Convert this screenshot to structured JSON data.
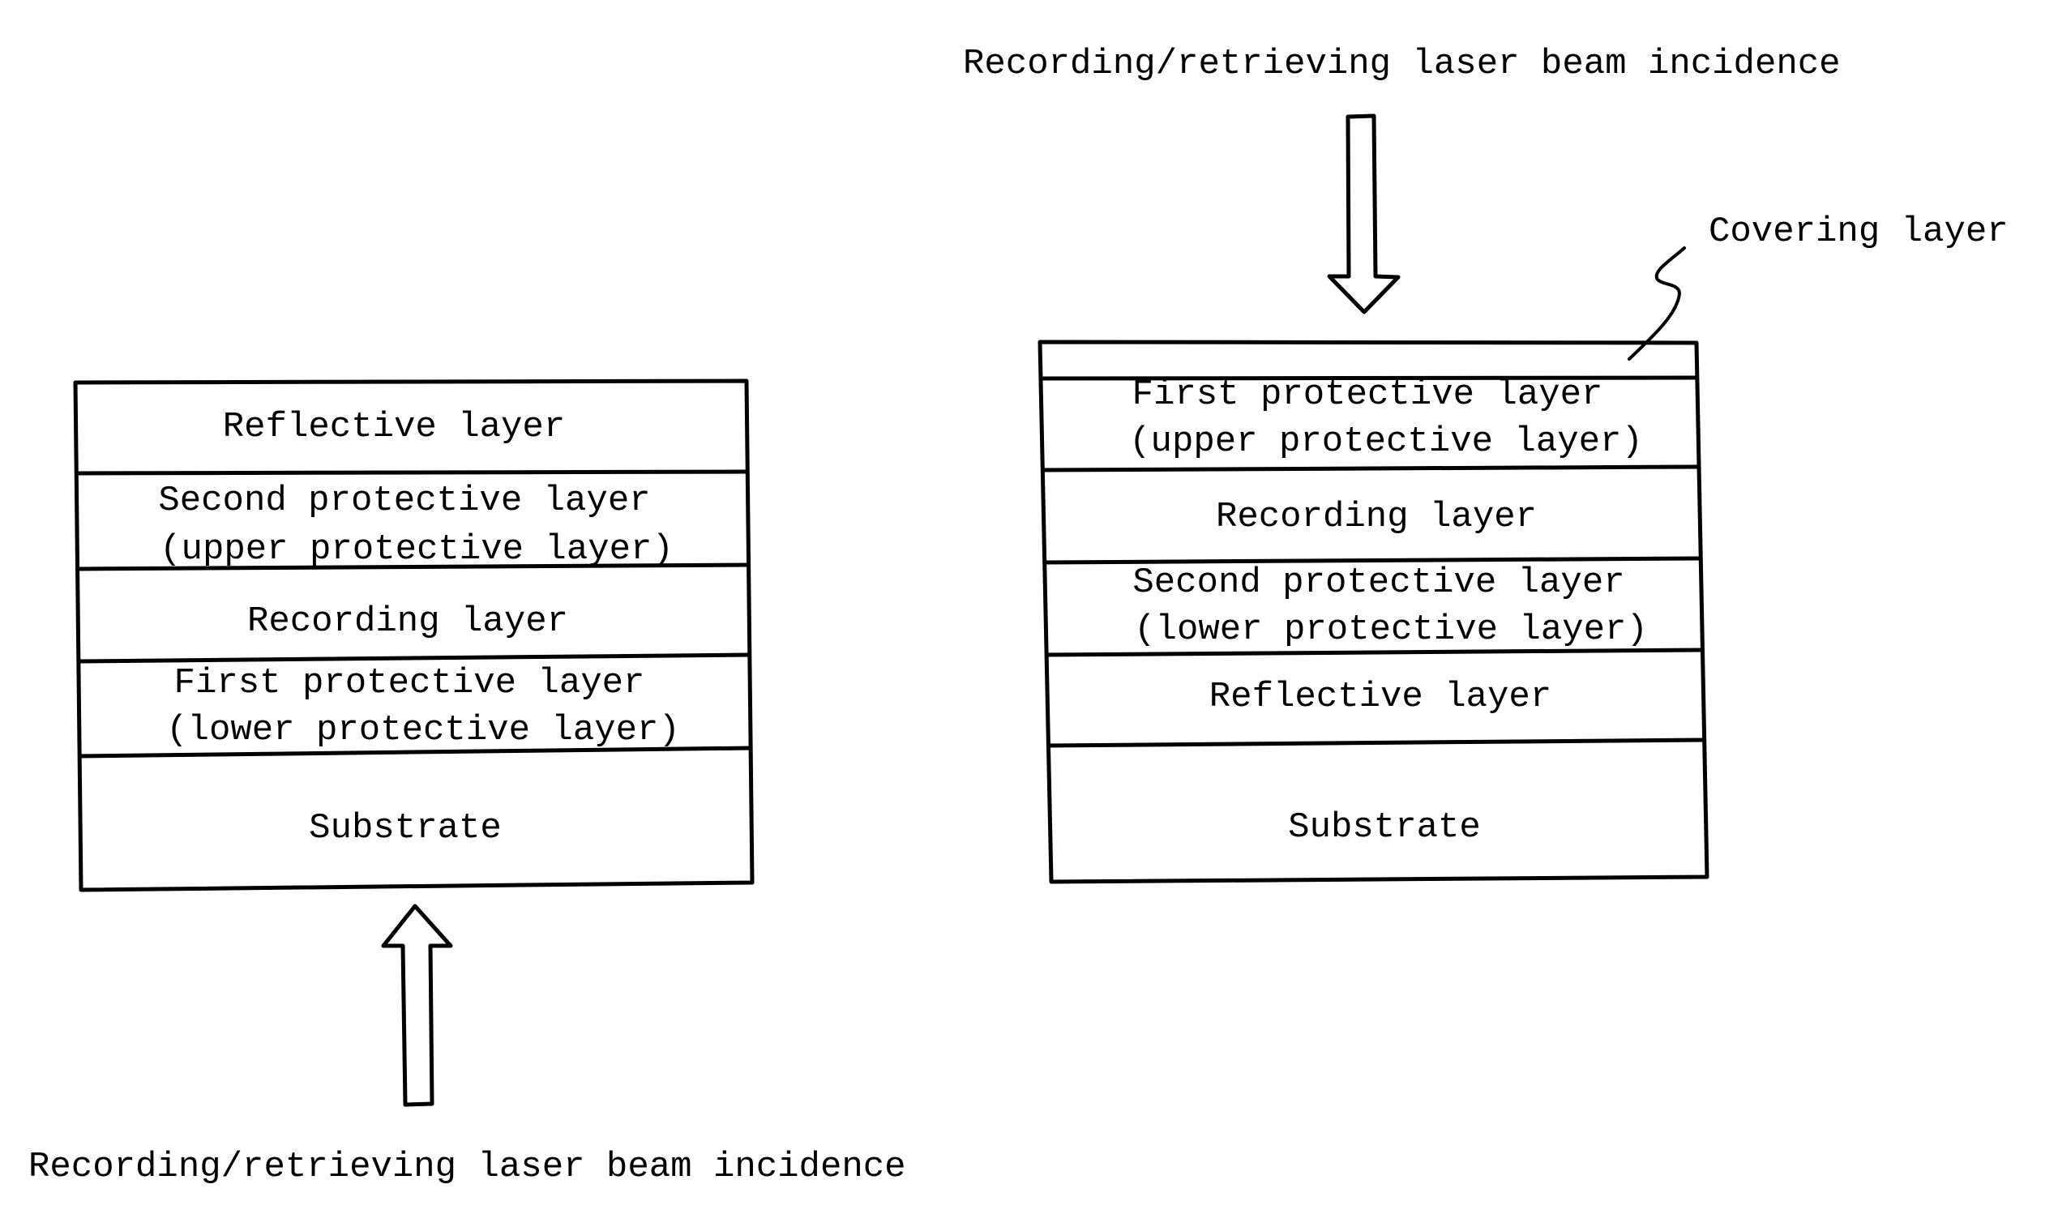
{
  "colors": {
    "ink": "#000000",
    "paper": "#ffffff"
  },
  "left_figure": {
    "laser_label": "Recording/retrieving laser beam incidence",
    "arrow_direction": "up",
    "layers": [
      {
        "id": "reflective",
        "lines": [
          "Reflective layer"
        ]
      },
      {
        "id": "second-protective",
        "lines": [
          "Second protective layer",
          "(upper protective layer)"
        ]
      },
      {
        "id": "recording",
        "lines": [
          "Recording layer"
        ]
      },
      {
        "id": "first-protective",
        "lines": [
          "First protective layer",
          "(lower protective layer)"
        ]
      },
      {
        "id": "substrate",
        "lines": [
          "Substrate"
        ]
      }
    ]
  },
  "right_figure": {
    "laser_label": "Recording/retrieving laser beam incidence",
    "arrow_direction": "down",
    "covering_label": "Covering layer",
    "layers": [
      {
        "id": "covering",
        "lines": []
      },
      {
        "id": "first-protective",
        "lines": [
          "First protective layer",
          "(upper protective layer)"
        ]
      },
      {
        "id": "recording",
        "lines": [
          "Recording layer"
        ]
      },
      {
        "id": "second-protective",
        "lines": [
          "Second protective layer",
          "(lower protective layer)"
        ]
      },
      {
        "id": "reflective",
        "lines": [
          "Reflective layer"
        ]
      },
      {
        "id": "substrate",
        "lines": [
          "Substrate"
        ]
      }
    ]
  }
}
